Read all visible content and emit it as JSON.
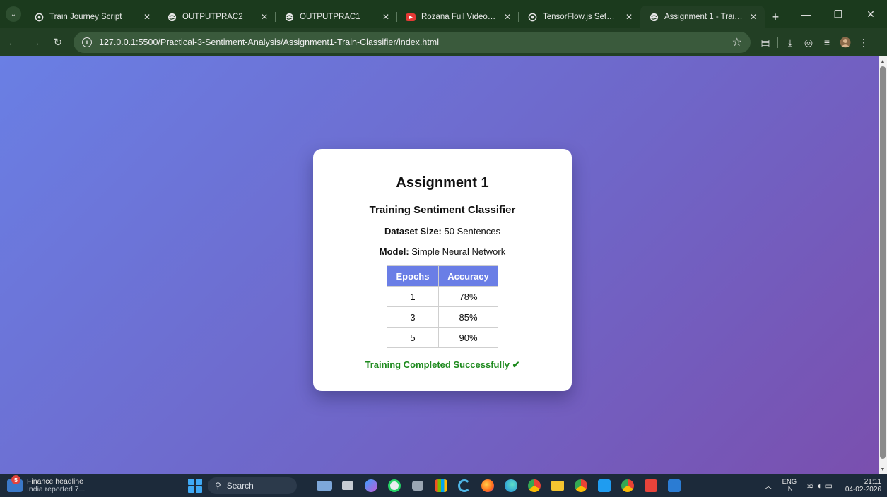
{
  "browser": {
    "tabs": [
      {
        "title": "Train Journey Script",
        "icon": "openai-icon",
        "active": false
      },
      {
        "title": "OUTPUTPRAC2",
        "icon": "globe-icon",
        "active": false
      },
      {
        "title": "OUTPUTPRAC1",
        "icon": "globe-icon",
        "active": false
      },
      {
        "title": "Rozana Full Video Song | N",
        "icon": "youtube-icon",
        "active": false
      },
      {
        "title": "TensorFlow.js Setup Guide",
        "icon": "openai-icon",
        "active": false
      },
      {
        "title": "Assignment 1 - Training",
        "icon": "globe-icon",
        "active": true
      }
    ],
    "url": "127.0.0.1:5500/Practical-3-Sentiment-Analysis/Assignment1-Train-Classifier/index.html"
  },
  "page": {
    "title": "Assignment 1",
    "subtitle": "Training Sentiment Classifier",
    "dataset_label": "Dataset Size:",
    "dataset_value": "50 Sentences",
    "model_label": "Model:",
    "model_value": "Simple Neural Network",
    "table": {
      "headers": [
        "Epochs",
        "Accuracy"
      ],
      "rows": [
        [
          "1",
          "78%"
        ],
        [
          "3",
          "85%"
        ],
        [
          "5",
          "90%"
        ]
      ]
    },
    "status": "Training Completed Successfully ✔",
    "colors": {
      "table_header": "#6a7ee6",
      "status": "#1e8a1e",
      "gradient_start": "#6a7fe4",
      "gradient_end": "#7a4fae"
    }
  },
  "taskbar": {
    "news_badge": "5",
    "news_title": "Finance headline",
    "news_sub": "India reported 7...",
    "search_label": "Search",
    "lang_top": "ENG",
    "lang_bottom": "IN",
    "time": "21:11",
    "date": "04-02-2026"
  }
}
